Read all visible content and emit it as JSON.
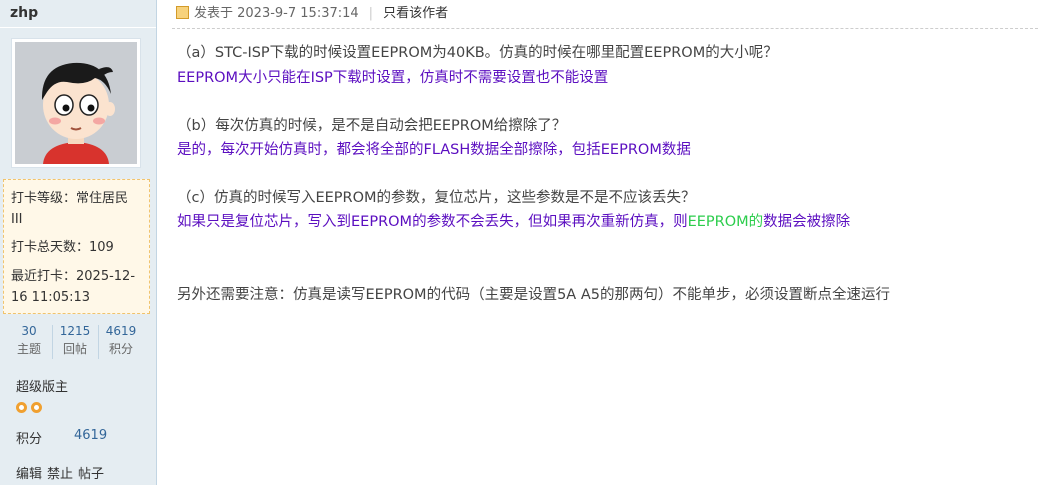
{
  "author": {
    "name": "zhp",
    "checkin": {
      "level_label": "打卡等级：常住居民",
      "level_label2": "III",
      "total_label": "打卡总天数：109",
      "recent_label": "最近打卡：2025-12-",
      "recent_label2": "16 11:05:13"
    },
    "stats": [
      {
        "value": "30",
        "label": "主题"
      },
      {
        "value": "1215",
        "label": "回帖"
      },
      {
        "value": "4619",
        "label": "积分"
      }
    ],
    "rank": "超级版主",
    "score_label": "积分",
    "score_value": "4619",
    "admin_links": [
      "编辑",
      "禁止",
      "帖子"
    ]
  },
  "post": {
    "posted_label": "发表于 2023-9-7 15:37:14",
    "only_author": "只看该作者",
    "q1": "（a）STC-ISP下载的时候设置EEPROM为40KB。仿真的时候在哪里配置EEPROM的大小呢？",
    "a1": "EEPROM大小只能在ISP下载时设置，仿真时不需要设置也不能设置",
    "q2": "（b）每次仿真的时候，是不是自动会把EEPROM给擦除了？",
    "a2": "是的，每次开始仿真时，都会将全部的FLASH数据全部擦除，包括EEPROM数据",
    "q3": "（c）仿真的时候写入EEPROM的参数，复位芯片，这些参数是不是不应该丢失？",
    "a3_part1": "如果只是复位芯片，写入到EEPROM的参数不会丢失，但如果再次重新仿真，则",
    "a3_part2": "EEPROM的",
    "a3_part3": "数据会被擦除",
    "note": "另外还需要注意：仿真是读写EEPROM的代码（主要是设置5A A5的那两句）不能单步，必须设置断点全速运行"
  },
  "colors": {
    "question": "#444444",
    "answer": "#5b0ec0",
    "highlight": "#2ccd4c",
    "link": "#336699",
    "sidebar_bg": "#e5edf2"
  }
}
